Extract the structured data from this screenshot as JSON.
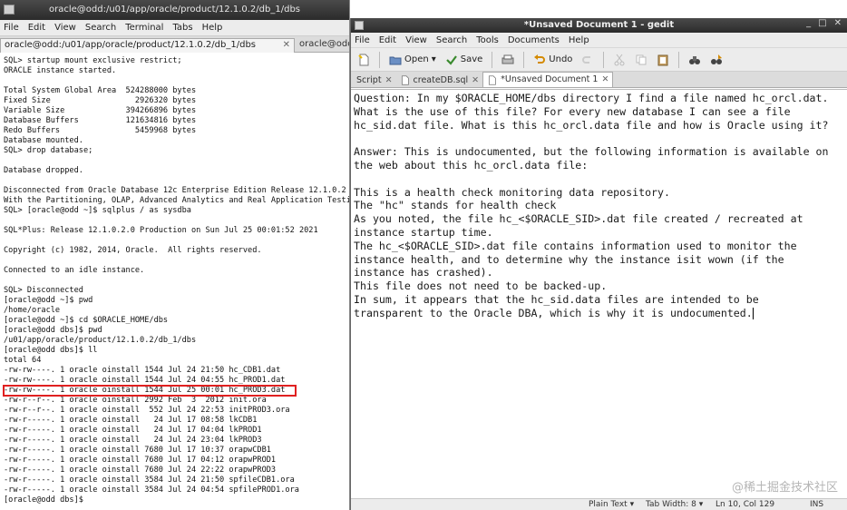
{
  "terminal": {
    "title": "oracle@odd:/u01/app/oracle/product/12.1.0.2/db_1/dbs",
    "menu": [
      "File",
      "Edit",
      "View",
      "Search",
      "Terminal",
      "Tabs",
      "Help"
    ],
    "tabs": [
      {
        "label": "oracle@odd:/u01/app/oracle/product/12.1.0.2/db_1/dbs",
        "close": "✕"
      },
      {
        "label": "oracle@odd:",
        "close": ""
      }
    ],
    "lines": [
      "SQL> startup mount exclusive restrict;",
      "ORACLE instance started.",
      "",
      "Total System Global Area  524288000 bytes",
      "Fixed Size                  2926320 bytes",
      "Variable Size             394266896 bytes",
      "Database Buffers          121634816 bytes",
      "Redo Buffers                5459968 bytes",
      "Database mounted.",
      "SQL> drop database;",
      "",
      "Database dropped.",
      "",
      "Disconnected from Oracle Database 12c Enterprise Edition Release 12.1.0.2",
      "With the Partitioning, OLAP, Advanced Analytics and Real Application Testi",
      "SQL> [oracle@odd ~]$ sqlplus / as sysdba",
      "",
      "SQL*Plus: Release 12.1.0.2.0 Production on Sun Jul 25 00:01:52 2021",
      "",
      "Copyright (c) 1982, 2014, Oracle.  All rights reserved.",
      "",
      "Connected to an idle instance.",
      "",
      "SQL> Disconnected",
      "[oracle@odd ~]$ pwd",
      "/home/oracle",
      "[oracle@odd ~]$ cd $ORACLE_HOME/dbs",
      "[oracle@odd dbs]$ pwd",
      "/u01/app/oracle/product/12.1.0.2/db_1/dbs",
      "[oracle@odd dbs]$ ll",
      "total 64",
      "-rw-rw----. 1 oracle oinstall 1544 Jul 24 21:50 hc_CDB1.dat",
      "-rw-rw----. 1 oracle oinstall 1544 Jul 24 04:55 hc_PROD1.dat",
      "-rw-rw----. 1 oracle oinstall 1544 Jul 25 00:01 hc_PROD3.dat",
      "-rw-r--r--. 1 oracle oinstall 2992 Feb  3  2012 init.ora",
      "-rw-r--r--. 1 oracle oinstall  552 Jul 24 22:53 initPROD3.ora",
      "-rw-r-----. 1 oracle oinstall   24 Jul 17 08:58 lkCDB1",
      "-rw-r-----. 1 oracle oinstall   24 Jul 17 04:04 lkPROD1",
      "-rw-r-----. 1 oracle oinstall   24 Jul 24 23:04 lkPROD3",
      "-rw-r-----. 1 oracle oinstall 7680 Jul 17 10:37 orapwCDB1",
      "-rw-r-----. 1 oracle oinstall 7680 Jul 17 04:12 orapwPROD1",
      "-rw-r-----. 1 oracle oinstall 7680 Jul 24 22:22 orapwPROD3",
      "-rw-r-----. 1 oracle oinstall 3584 Jul 24 21:50 spfileCDB1.ora",
      "-rw-r-----. 1 oracle oinstall 3584 Jul 24 04:54 spfilePROD1.ora",
      "[oracle@odd dbs]$ "
    ],
    "highlight_line": 33
  },
  "gedit": {
    "title": "*Unsaved Document 1 - gedit",
    "window_controls": [
      "_",
      "□",
      "✕"
    ],
    "menu": [
      "File",
      "Edit",
      "View",
      "Search",
      "Tools",
      "Documents",
      "Help"
    ],
    "toolbar": {
      "open": "Open",
      "save": "Save",
      "undo": "Undo"
    },
    "tabs": [
      {
        "label": "Script",
        "close": "✕"
      },
      {
        "label": "createDB.sql",
        "close": "✕"
      },
      {
        "label": "*Unsaved Document 1",
        "close": "✕"
      }
    ],
    "document": "Question: In my $ORACLE_HOME/dbs directory I find a file named hc_orcl.dat.\nWhat is the use of this file? For every new database I can see a file\nhc_sid.dat file. What is this hc_orcl.data file and how is Oracle using it?\n\nAnswer: This is undocumented, but the following information is available on\nthe web about this hc_orcl.data file:\n\nThis is a health check monitoring data repository.\nThe \"hc\" stands for health check\nAs you noted, the file hc_<$ORACLE_SID>.dat file created / recreated at\ninstance startup time.\nThe hc_<$ORACLE_SID>.dat file contains information used to monitor the\ninstance health, and to determine why the instance isit wown (if the\ninstance has crashed).\nThis file does not need to be backed-up.\nIn sum, it appears that the hc_sid.data files are intended to be\ntransparent to the Oracle DBA, which is why it is undocumented.",
    "status": {
      "language": "Plain Text ▾",
      "tab_width": "Tab Width: 8 ▾",
      "position": "Ln 10, Col 129",
      "mode": "INS"
    }
  },
  "watermark": "@稀土掘金技术社区",
  "colors": {
    "highlight": "#e02020",
    "titlebar": "#2b2b2b"
  }
}
